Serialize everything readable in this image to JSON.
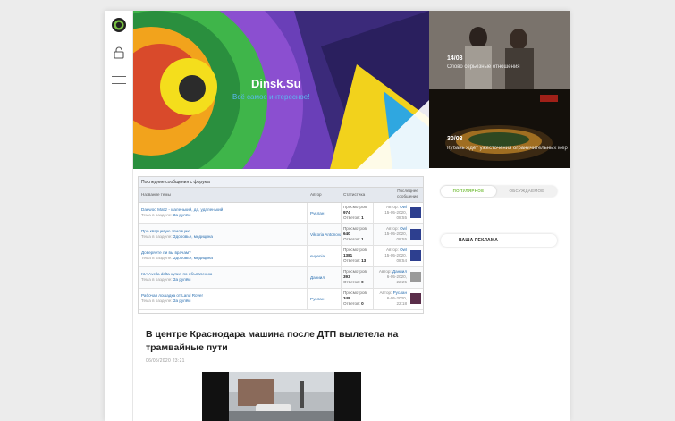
{
  "site": {
    "name": "Dinsk.Su",
    "tagline": "Всё самое интересное!"
  },
  "side_news": [
    {
      "date": "14/03",
      "title": "Слово серьёзные отношения"
    },
    {
      "date": "30/03",
      "title": "Кубань ждёт ужесточения ограничительных мер"
    }
  ],
  "forum": {
    "heading": "Последние сообщения с форума",
    "columns": {
      "topic": "Название темы",
      "author": "Автор",
      "stats": "Статистика",
      "last": "Последнее сообщение"
    },
    "labels": {
      "views": "Просмотров:",
      "replies": "Ответов:",
      "section": "Тема в разделе:",
      "author_prefix": "Автор:"
    },
    "rows": [
      {
        "topic": "Daewoo Matiz - маленький, да, удаленький",
        "section": "За рулём",
        "author": "Руслан",
        "views": "974",
        "replies": "1",
        "last_author": "Owl",
        "last_date": "15-05-2020,",
        "last_time": "08:55",
        "avatar_color": "#2d3f8f"
      },
      {
        "topic": "Про кварцевую эпиляцию",
        "section": "Здоровье, медицина",
        "author": "Viktoria Antonova",
        "views": "640",
        "replies": "1",
        "last_author": "Owl",
        "last_date": "15-05-2020,",
        "last_time": "08:55",
        "avatar_color": "#2d3f8f"
      },
      {
        "topic": "Доверяете ли вы врачам?",
        "section": "Здоровье, медицина",
        "author": "evgenia",
        "views": "1381",
        "replies": "13",
        "last_author": "Owl",
        "last_date": "15-05-2020,",
        "last_time": "08:54",
        "avatar_color": "#2d3f8f"
      },
      {
        "topic": "KIA Avella delta купил по объявлению",
        "section": "За рулём",
        "author": "Даниил",
        "views": "393",
        "replies": "0",
        "last_author": "Даниил",
        "last_date": "6-05-2020,",
        "last_time": "22:25",
        "avatar_color": "#9a9a9a"
      },
      {
        "topic": "Рабочая лошадка от Land Rover",
        "section": "За рулём",
        "author": "Руслан",
        "views": "348",
        "replies": "0",
        "last_author": "Руслан",
        "last_date": "6-05-2020,",
        "last_time": "22:18",
        "avatar_color": "#5a2d4a"
      }
    ]
  },
  "article": {
    "title": "В центре Краснодара машина после ДТП вылетела на трамвайные пути",
    "date": "06/05/2020 23:21"
  },
  "tabs": {
    "popular": "ПОПУЛЯРНОЕ",
    "discussed": "ОБСУЖДАЕМОЕ"
  },
  "ad_button": "ВАША РЕКЛАМА",
  "colors": {
    "accent_green": "#7ac143",
    "link_blue": "#2a6fb0"
  },
  "icons": [
    "logo-icon",
    "lock-icon",
    "menu-icon"
  ]
}
